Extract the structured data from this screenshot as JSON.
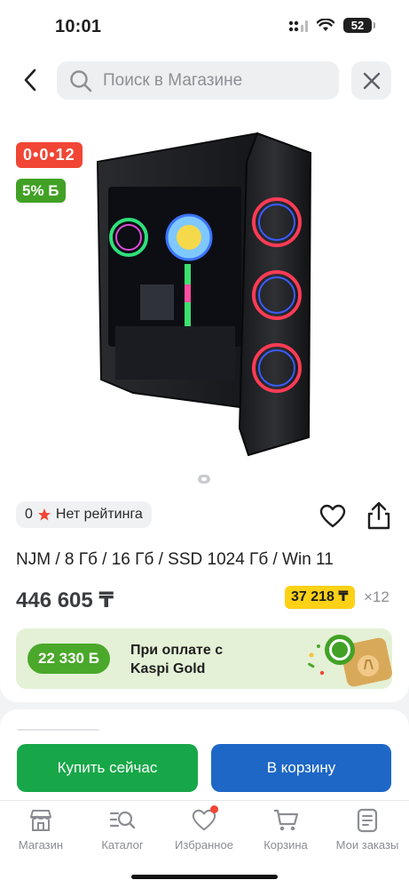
{
  "status_bar": {
    "time": "10:01",
    "battery": "52"
  },
  "header": {
    "search_placeholder": "Поиск в Магазине"
  },
  "product": {
    "installment_badge": "0•0•12",
    "bonus_badge": "5% Б",
    "rating_count": "0",
    "rating_text": "Нет рейтинга",
    "title": "NJM / 8 Гб / 16 Гб /  SSD 1024 Гб / Win 11",
    "price": "446 605 ₸",
    "monthly_payment": "37 218 ₸",
    "monthly_count": "×12",
    "kaspi_gold": {
      "amount": "22 330 Б",
      "text": "При оплате с Kaspi Gold"
    }
  },
  "actions": {
    "buy_now": "Купить сейчас",
    "add_to_cart": "В корзину"
  },
  "tab_bar": {
    "items": [
      {
        "label": "Магазин",
        "icon": "store-icon"
      },
      {
        "label": "Каталог",
        "icon": "catalog-search-icon"
      },
      {
        "label": "Избранное",
        "icon": "heart-icon"
      },
      {
        "label": "Корзина",
        "icon": "cart-icon"
      },
      {
        "label": "Мои заказы",
        "icon": "orders-icon"
      }
    ]
  },
  "colors": {
    "installment_red": "#f14635",
    "bonus_green": "#41a125",
    "buy_green": "#17a748",
    "cart_blue": "#1e67c6",
    "monthly_yellow": "#fcd116"
  }
}
